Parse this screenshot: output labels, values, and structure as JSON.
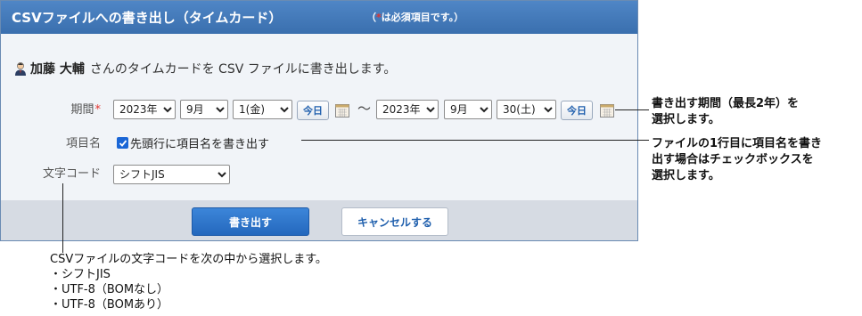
{
  "dialog": {
    "title": "CSVファイルへの書き出し（タイムカード）",
    "required_note_prefix": "（",
    "required_star": "*",
    "required_note_text": "は必須項目です。）"
  },
  "intro": {
    "username": "加藤 大輔",
    "message": "さんのタイムカードを CSV ファイルに書き出します。"
  },
  "form": {
    "period_label": "期間",
    "required_marker": "*",
    "start": {
      "year": "2023年",
      "month": "9月",
      "day": "1(金)"
    },
    "end": {
      "year": "2023年",
      "month": "9月",
      "day": "30(土)"
    },
    "today_label": "今日",
    "range_separator": "〜",
    "item_name_label": "項目名",
    "item_name_checkbox": "先頭行に項目名を書き出す",
    "item_name_checked": true,
    "charset_label": "文字コード",
    "charset_value": "シフトJIS"
  },
  "footer": {
    "export_label": "書き出す",
    "cancel_label": "キャンセルする"
  },
  "annotations": {
    "period": "書き出す期間（最長2年）を\n選択します。",
    "item_name": "ファイルの1行目に項目名を書き\n出す場合はチェックボックスを\n選択します。",
    "charset_intro": "CSVファイルの文字コードを次の中から選択します。",
    "charset_options": [
      "・シフトJIS",
      "・UTF-8（BOMなし）",
      "・UTF-8（BOMあり）"
    ]
  },
  "colors": {
    "title_bar": "#3a6fae",
    "primary_button": "#2468bd",
    "required": "#e3342f"
  }
}
